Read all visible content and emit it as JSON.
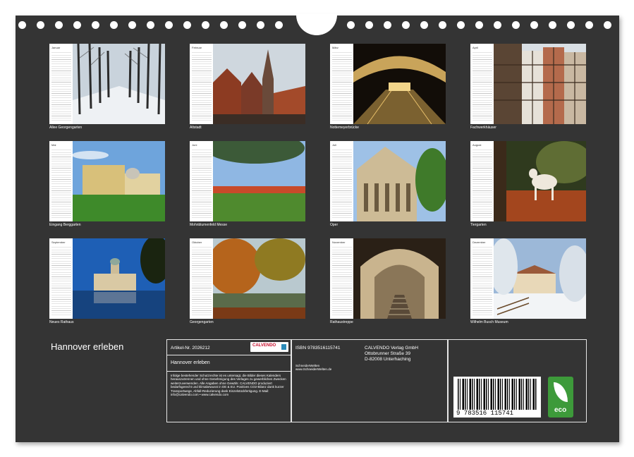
{
  "title": "Hannover erleben",
  "months": [
    {
      "month": "Januar",
      "caption": "Allee Georgengarten"
    },
    {
      "month": "Februar",
      "caption": "Altstadt"
    },
    {
      "month": "März",
      "caption": "Nottemeyerbrücke"
    },
    {
      "month": "April",
      "caption": "Fachwerkhäuser"
    },
    {
      "month": "Mai",
      "caption": "Eingang Berggarten"
    },
    {
      "month": "Juni",
      "caption": "Mohnblumenfeld Messe"
    },
    {
      "month": "Juli",
      "caption": "Oper"
    },
    {
      "month": "August",
      "caption": "Tiergarten"
    },
    {
      "month": "September",
      "caption": "Neues Rathaus"
    },
    {
      "month": "Oktober",
      "caption": "Georgengarten"
    },
    {
      "month": "November",
      "caption": "Rathaustreppe"
    },
    {
      "month": "Dezember",
      "caption": "Wilhelm Busch Museum"
    }
  ],
  "info": {
    "artikel": "Artikel-Nr. 2026212",
    "calvendo_logo": "CALVENDO",
    "product_title": "Hannover erleben",
    "legal": "Infolge bestehender Schutzrechte ist es untersagt, die Bilder dieses Kalenders herauszutrennen und ohne Genehmigung des Verlages zu gewerblichen Zwecken weiterzuverwenden. Alle Angaben ohne Gewähr. CALVENDO produziert bedarfsgerecht und klimabewusst in DE & EU. Positives CO2-Bilanz dank kurzer Transportwege, Abfall-Reduzierung dank Einzelstückfertigung. E-Mail: info@calvendo.com • www.calvendo.com",
    "isbn": "ISBN 9783516115741",
    "publisher_name": "CALVENDO Verlag GmbH",
    "publisher_street": "Ottobrunner Straße 39",
    "publisher_city": "D-82008 Unterhaching",
    "author_name": "SchneiderWelten",
    "author_url": "www.SchneiderWelten.de",
    "barcode_digits": "9 783516 115741",
    "eco_label": "eco"
  },
  "colors": {
    "board": "#343434",
    "text": "#ffffff",
    "eco_green": "#3d9a3a"
  }
}
